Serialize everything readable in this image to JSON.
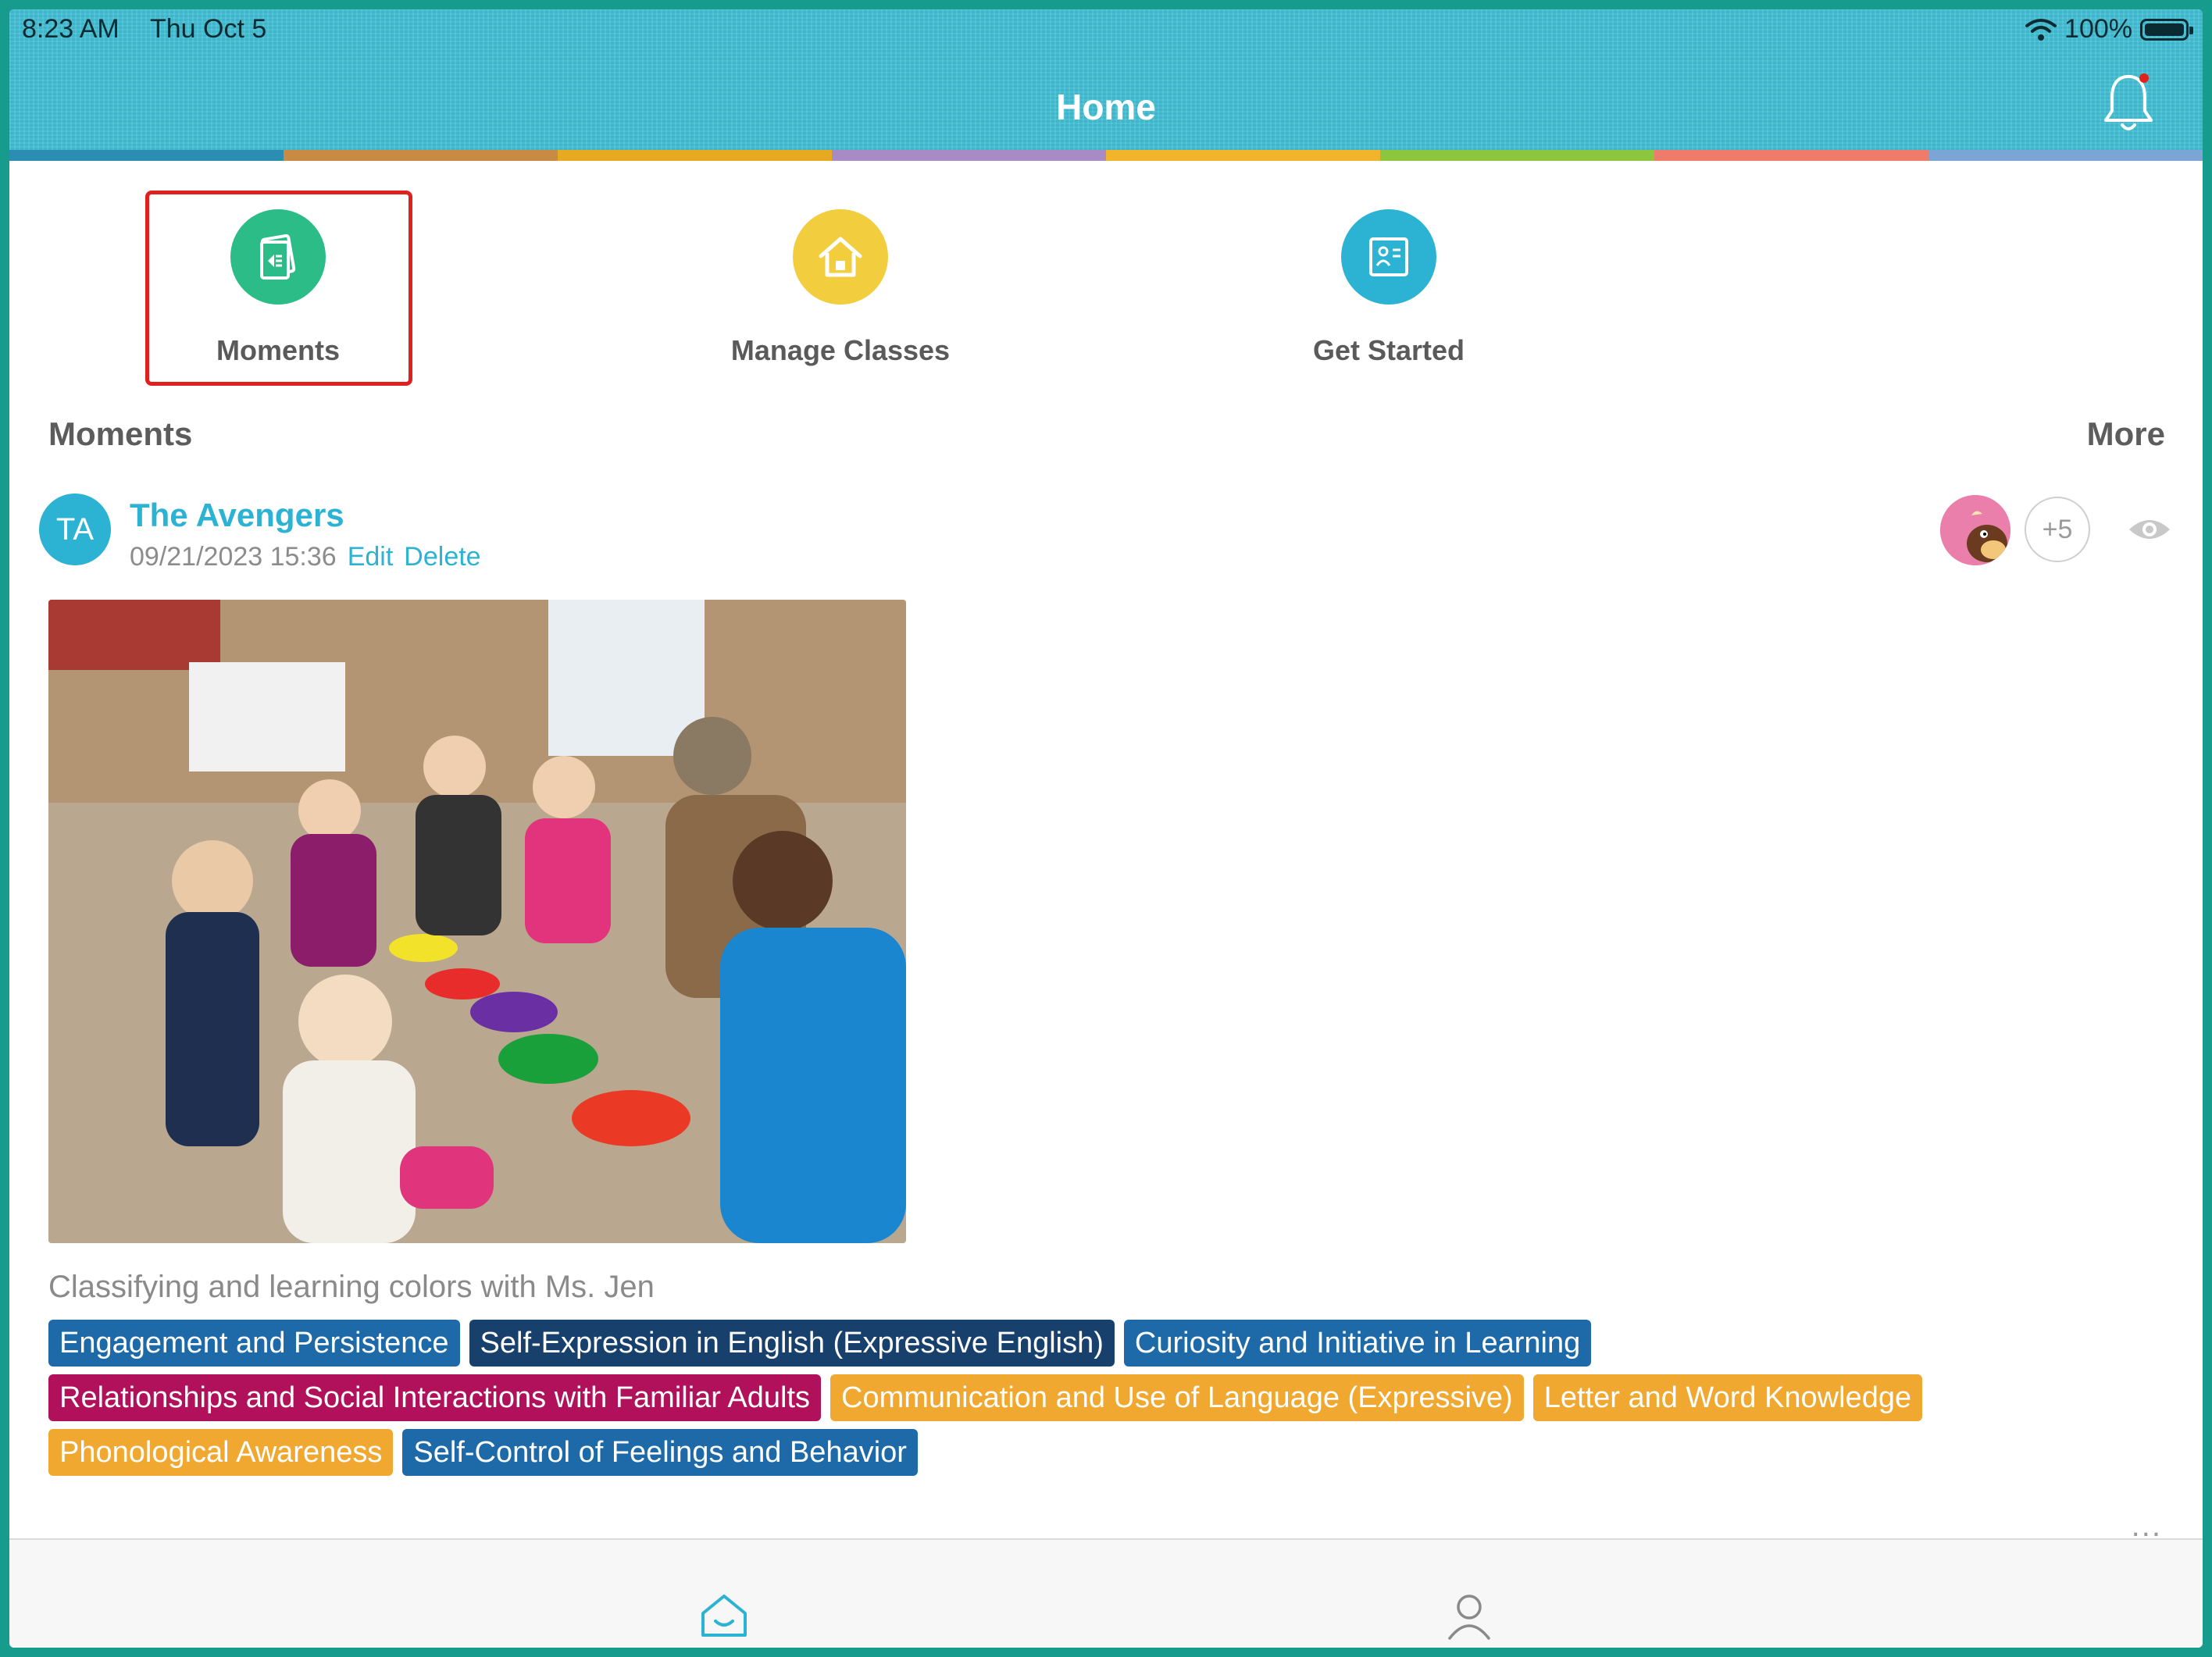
{
  "status_bar": {
    "time": "8:23 AM",
    "date": "Thu Oct 5",
    "battery": "100%"
  },
  "header": {
    "title": "Home",
    "accent_color": "#44c1d6"
  },
  "rainbow_colors": [
    "#2c8db3",
    "#c98b43",
    "#e6a91f",
    "#a88bc5",
    "#f2b42a",
    "#8cc63f",
    "#ef7b6a",
    "#7aa5d6"
  ],
  "quick_actions": [
    {
      "label": "Moments",
      "color": "#2bbc88",
      "icon": "moments-icon",
      "highlighted": true
    },
    {
      "label": "Manage Classes",
      "color": "#f2cd3d",
      "icon": "home-icon"
    },
    {
      "label": "Get Started",
      "color": "#2cb3d3",
      "icon": "get-started-icon"
    }
  ],
  "moments_section": {
    "title": "Moments",
    "more_label": "More"
  },
  "post": {
    "avatar_initials": "TA",
    "class_name": "The Avengers",
    "timestamp": "09/21/2023 15:36",
    "edit_label": "Edit",
    "delete_label": "Delete",
    "extra_children": "+5",
    "caption": "Classifying and learning colors with Ms. Jen",
    "tags": [
      {
        "label": "Engagement and Persistence",
        "color": "#1e6aa8"
      },
      {
        "label": "Self-Expression in English (Expressive English)",
        "color": "#17406d"
      },
      {
        "label": "Curiosity and Initiative in Learning",
        "color": "#1e6aa8"
      },
      {
        "label": "Relationships and Social Interactions with Familiar Adults",
        "color": "#b0115a"
      },
      {
        "label": "Communication and Use of Language (Expressive)",
        "color": "#f0a830"
      },
      {
        "label": "Letter and Word Knowledge",
        "color": "#f0a830"
      },
      {
        "label": "Phonological Awareness",
        "color": "#f0a830"
      },
      {
        "label": "Self-Control of Feelings and Behavior",
        "color": "#1e6aa8"
      }
    ],
    "more_options": "..."
  },
  "tab_bar": [
    {
      "icon": "home-icon",
      "active": true
    },
    {
      "icon": "profile-icon",
      "active": false
    }
  ]
}
